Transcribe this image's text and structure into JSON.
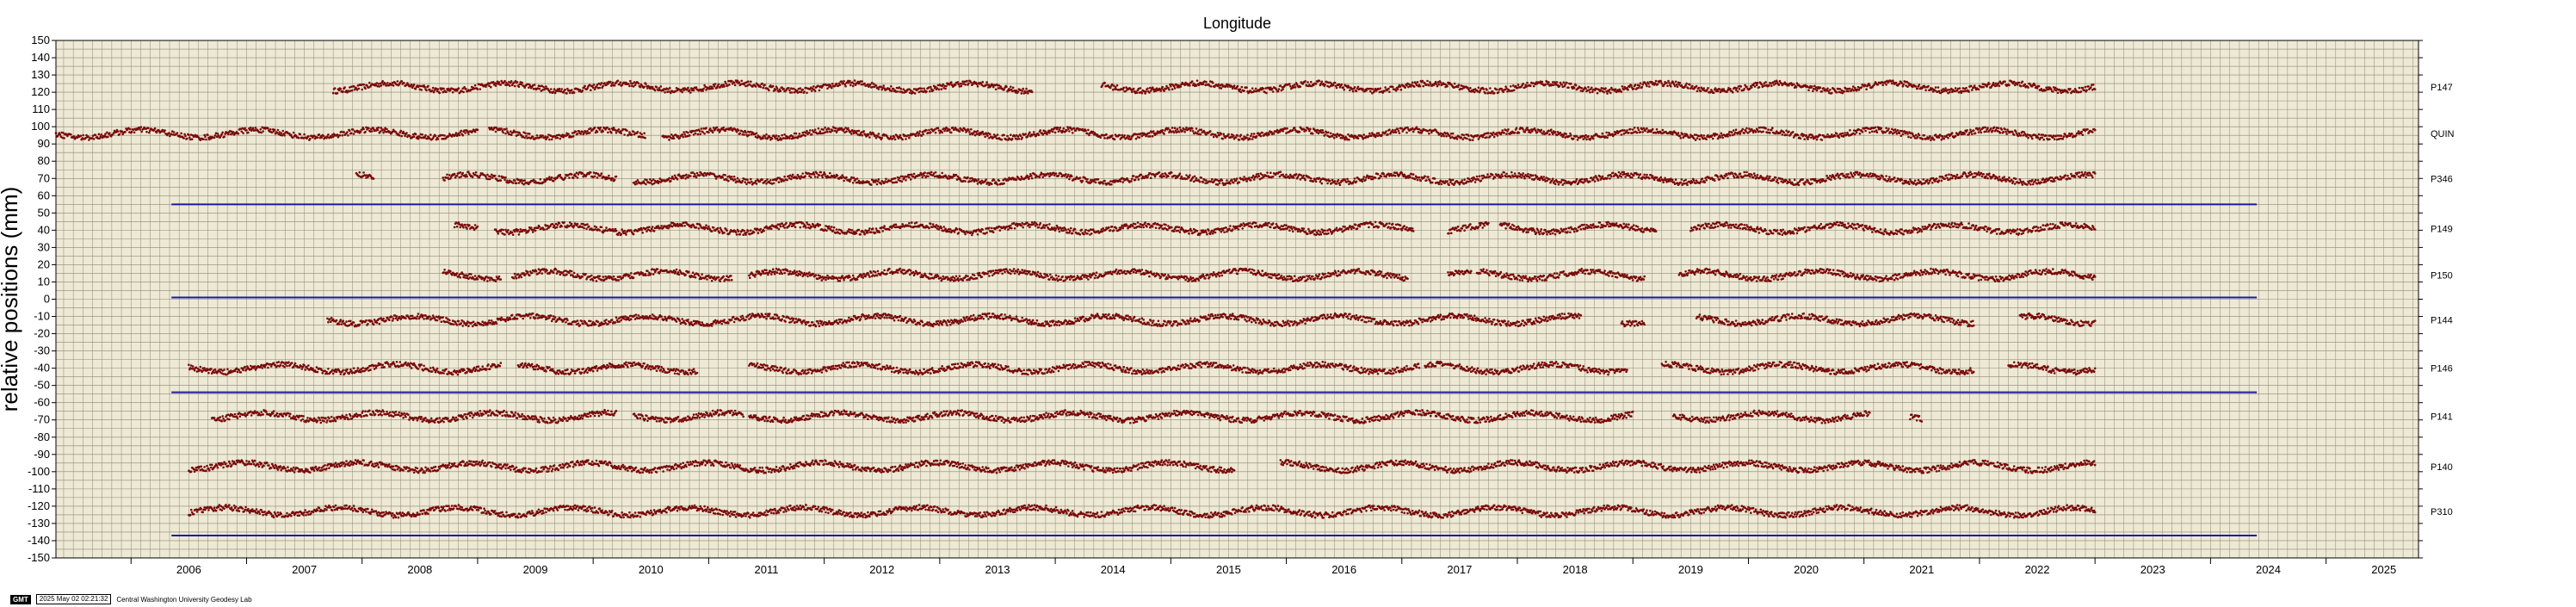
{
  "chart_data": {
    "type": "scatter",
    "title": "Longitude",
    "ylabel": "relative positions (mm)",
    "xlim": [
      2005.35,
      2025.8
    ],
    "ylim": [
      -150,
      150
    ],
    "yticks": [
      150,
      140,
      130,
      120,
      110,
      100,
      90,
      80,
      70,
      60,
      50,
      40,
      30,
      20,
      10,
      0,
      -10,
      -20,
      -30,
      -40,
      -50,
      -60,
      -70,
      -80,
      -90,
      -100,
      -110,
      -120,
      -130,
      -140,
      -150
    ],
    "xtick_labels": [
      "2006",
      "2007",
      "2008",
      "2009",
      "2010",
      "2011",
      "2012",
      "2013",
      "2014",
      "2015",
      "2016",
      "2017",
      "2018",
      "2019",
      "2020",
      "2021",
      "2022",
      "2023",
      "2024",
      "2025"
    ],
    "grid": true,
    "point_color": "#7a0a0a",
    "line_color": "#1c1ca0",
    "background": "#ede9d5",
    "series": [
      {
        "name": "P147",
        "baseline": 123,
        "segments": [
          [
            2007.75,
            2013.8
          ],
          [
            2014.4,
            2020.6
          ],
          [
            2020.6,
            2023.0
          ]
        ]
      },
      {
        "name": "QUIN",
        "baseline": 96,
        "segments": [
          [
            2005.35,
            2008.2
          ],
          [
            2008.2,
            2009.0
          ],
          [
            2009.1,
            2010.45
          ],
          [
            2010.6,
            2023.0
          ]
        ]
      },
      {
        "name": "P346",
        "baseline": 70,
        "segments": [
          [
            2007.95,
            2008.1
          ],
          [
            2008.7,
            2010.2
          ],
          [
            2010.35,
            2023.0
          ]
        ]
      },
      {
        "name": "P149",
        "baseline": 41,
        "segments": [
          [
            2008.8,
            2009.0
          ],
          [
            2009.15,
            2017.1
          ],
          [
            2017.4,
            2017.75
          ],
          [
            2017.85,
            2019.2
          ],
          [
            2019.5,
            2023.0
          ]
        ]
      },
      {
        "name": "P150",
        "baseline": 14,
        "segments": [
          [
            2008.7,
            2009.2
          ],
          [
            2009.3,
            2011.2
          ],
          [
            2011.35,
            2017.05
          ],
          [
            2017.4,
            2017.6
          ],
          [
            2017.65,
            2019.1
          ],
          [
            2019.4,
            2023.0
          ]
        ]
      },
      {
        "name": "P144",
        "baseline": -12,
        "segments": [
          [
            2007.7,
            2013.8
          ],
          [
            2013.8,
            2018.55
          ],
          [
            2018.9,
            2019.1
          ],
          [
            2019.55,
            2019.7
          ],
          [
            2019.7,
            2021.95
          ],
          [
            2022.35,
            2023.0
          ]
        ]
      },
      {
        "name": "P146",
        "baseline": -40,
        "segments": [
          [
            2006.5,
            2009.2
          ],
          [
            2009.35,
            2010.9
          ],
          [
            2011.35,
            2017.15
          ],
          [
            2017.2,
            2018.25
          ],
          [
            2018.25,
            2018.95
          ],
          [
            2019.25,
            2021.95
          ],
          [
            2022.25,
            2023.0
          ]
        ]
      },
      {
        "name": "P141",
        "baseline": -68,
        "segments": [
          [
            2006.7,
            2010.2
          ],
          [
            2010.35,
            2011.3
          ],
          [
            2011.35,
            2019.0
          ],
          [
            2019.35,
            2021.05
          ],
          [
            2021.4,
            2021.5
          ]
        ]
      },
      {
        "name": "P140",
        "baseline": -97,
        "segments": [
          [
            2006.5,
            2015.55
          ],
          [
            2015.95,
            2023.0
          ]
        ]
      },
      {
        "name": "P310",
        "baseline": -123,
        "segments": [
          [
            2006.5,
            2023.0
          ]
        ]
      }
    ],
    "offset_lines": [
      55,
      1,
      -54,
      -137
    ],
    "offset_line_range": [
      2006.35,
      2024.4
    ]
  },
  "footer": {
    "logo": "GMT",
    "timestamp": "2025 May 02 02:21:32",
    "credit": "Central Washington University Geodesy Lab"
  }
}
